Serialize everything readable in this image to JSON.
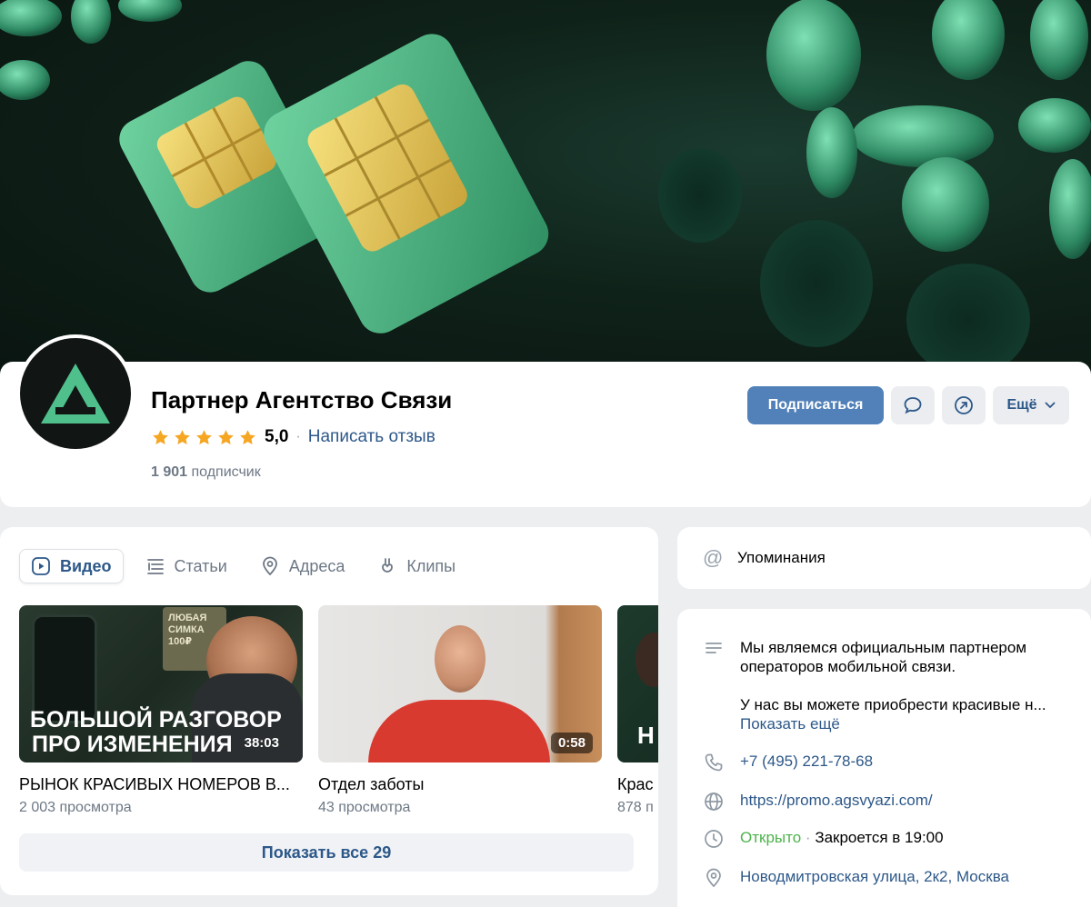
{
  "group": {
    "name": "Партнер Агентство Связи",
    "rating": "5,0",
    "rating_stars": 5,
    "review_link": "Написать отзыв",
    "subscribers_count": "1 901",
    "subscribers_label": "подписчик"
  },
  "actions": {
    "subscribe": "Подписаться",
    "message_icon": "message-icon",
    "share_icon": "share-icon",
    "more": "Ещё"
  },
  "tabs": [
    {
      "label": "Видео",
      "icon": "video-icon",
      "active": true
    },
    {
      "label": "Статьи",
      "icon": "articles-icon",
      "active": false
    },
    {
      "label": "Адреса",
      "icon": "location-icon",
      "active": false
    },
    {
      "label": "Клипы",
      "icon": "clips-icon",
      "active": false
    }
  ],
  "videos": [
    {
      "title": "РЫНОК КРАСИВЫХ НОМЕРОВ В...",
      "views": "2 003 просмотра",
      "duration": "38:03",
      "thumb_text_1": "БОЛЬШОЙ РАЗГОВОР",
      "thumb_text_2": "ПРО ИЗМЕНЕНИЯ",
      "thumb_side": "ЛЮБАЯ СИМКА 100₽"
    },
    {
      "title": "Отдел заботы",
      "views": "43 просмотра",
      "duration": "0:58"
    },
    {
      "title": "Крас",
      "views": "878 п",
      "thumb_text_1": "Н"
    }
  ],
  "show_all": "Показать все 29",
  "mentions": "Упоминания",
  "info": {
    "description_1": "Мы являемся официальным партнером операторов мобильной связи.",
    "description_2": "У нас вы можете приобрести красивые н...",
    "show_more": "Показать ещё",
    "phone": "+7 (495) 221-78-68",
    "website": "https://promo.agsvyazi.com/",
    "status_open": "Открыто",
    "status_close": "Закроется в 19:00",
    "address": "Новодмитровская улица, 2к2, Москва"
  },
  "colors": {
    "accent": "#5181b8",
    "link": "#2d5889",
    "open": "#4bb34b",
    "star": "#f5a623",
    "logo_green": "#4fbf8b"
  }
}
